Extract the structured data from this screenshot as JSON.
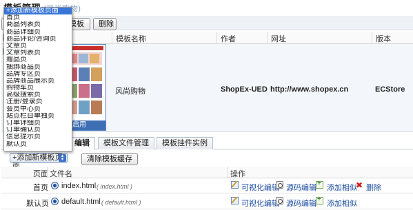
{
  "page": {
    "title": "模板管理",
    "title_faint": "(风尚购物)"
  },
  "toolbar": {
    "partial_button": "+",
    "template_button": "模板",
    "delete_button": "删除"
  },
  "table": {
    "columns": [
      "模板名称",
      "作者",
      "网址",
      "版本"
    ],
    "row": {
      "name": "风尚购物",
      "author": "ShopEx-UED",
      "url": "http://www.shopex.cn",
      "version": "ECStore",
      "thumb_badge": "启用"
    }
  },
  "tabs": [
    {
      "label": "编辑",
      "active": true
    },
    {
      "label": "模板文件管理",
      "active": false
    },
    {
      "label": "模板挂件实例",
      "active": false
    }
  ],
  "subtoolbar": {
    "select_value": "+添加新模板页面",
    "clear_button": "清除模板缓存"
  },
  "grid": {
    "headers": {
      "page": "页面",
      "filename": "文件名",
      "actions": "操作"
    },
    "rows": [
      {
        "page": "首页",
        "file": "index.html",
        "file_hint": "( index.html )",
        "actions": [
          "可视化编辑",
          "源码编辑",
          "添加相似",
          "删除"
        ]
      },
      {
        "page": "默认页",
        "file": "default.html",
        "file_hint": "( default.html )",
        "actions": [
          "可视化编辑",
          "源码编辑",
          "添加相似"
        ]
      }
    ]
  },
  "dropdown": {
    "selected": "+添加新模板页面",
    "options": [
      "+添加新模板页面",
      "首页",
      "商品列表页",
      "商品详细页",
      "商品评论/咨询页",
      "文章页",
      "文章列表页",
      "赠品页",
      "捆绑商品页",
      "品牌专区页",
      "品牌商品展示页",
      "购物车页",
      "高级搜索页",
      "注册/登录页",
      "会员中心页",
      "站点栏目单独页",
      "订单详细页",
      "订单确认页",
      "信息提示页",
      "默认页"
    ]
  },
  "colors": {
    "accent": "#3875d7",
    "link": "#1f4fa0",
    "delete": "#d01b1b"
  }
}
